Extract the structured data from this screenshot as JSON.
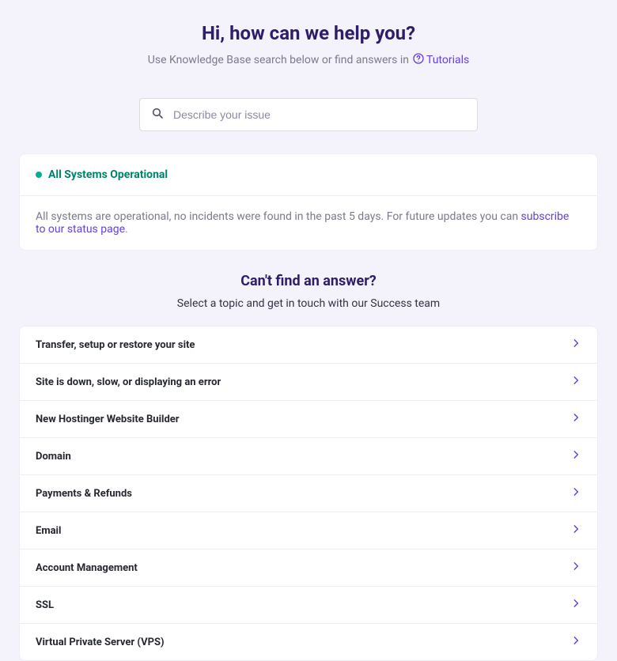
{
  "header": {
    "title": "Hi, how can we help you?",
    "subtitle_prefix": "Use Knowledge Base search below or find answers in",
    "tutorials_label": "Tutorials"
  },
  "search": {
    "placeholder": "Describe your issue"
  },
  "status": {
    "title": "All Systems Operational",
    "body_prefix": "All systems are operational, no incidents were found in the past 5 days. For future updates you can ",
    "link_text": "subscribe to our status page",
    "body_suffix": "."
  },
  "cant_find": {
    "title": "Can't find an answer?",
    "subtitle": "Select a topic and get in touch with our Success team"
  },
  "topics": [
    {
      "label": "Transfer, setup or restore your site"
    },
    {
      "label": "Site is down, slow, or displaying an error"
    },
    {
      "label": "New Hostinger Website Builder"
    },
    {
      "label": "Domain"
    },
    {
      "label": "Payments & Refunds"
    },
    {
      "label": "Email"
    },
    {
      "label": "Account Management"
    },
    {
      "label": "SSL"
    },
    {
      "label": "Virtual Private Server (VPS)"
    }
  ]
}
